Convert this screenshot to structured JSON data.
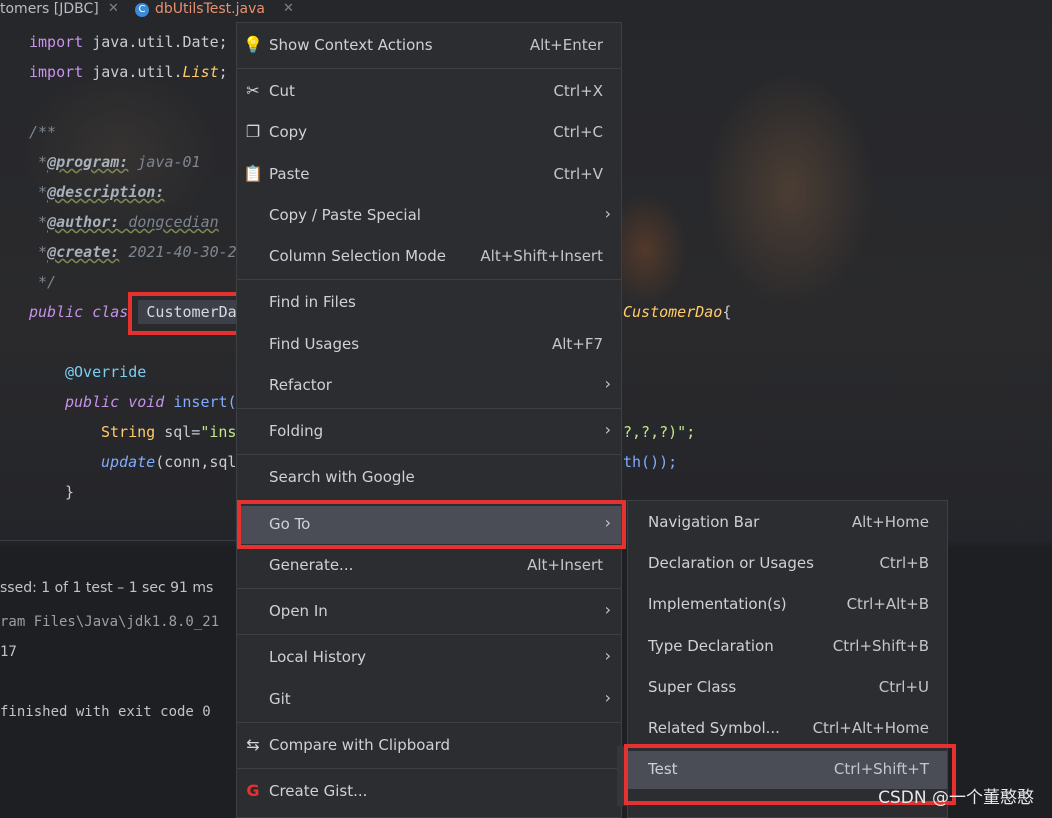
{
  "tabs": [
    {
      "label": "tomers [JDBC]",
      "close": "✕"
    },
    {
      "label": "dbUtilsTest.java",
      "close": "✕"
    }
  ],
  "code": {
    "l1_import": "import",
    "l1_rest": " java.util.Date;",
    "l2_import": "import",
    "l2_pkg": " java.util.",
    "l2_cls": "List",
    "l2_semi": ";",
    "l4": "/**",
    "l5_star": " *",
    "l5_tag": "@program:",
    "l5_val": " java-01",
    "l6_star": " *",
    "l6_tag": "@description:",
    "l7_star": " *",
    "l7_tag": "@author:",
    "l7_val": " dongcedian",
    "l8_star": " *",
    "l8_tag": "@create:",
    "l8_val": " 2021-40-30-2",
    "l9": " */",
    "l10_kw": "public",
    "l10_kw2": "clas",
    "l10_cls": "CustomerDa",
    "l10_iface": "CustomerDao",
    "l10_brace": "{",
    "l12_ann": "@Override",
    "l13_kw": "public",
    "l13_kw2": "void",
    "l13_fn": "insert(",
    "l14_type": "String",
    "l14_var": " sql=",
    "l14_str": "\"ins",
    "l14_tail": "?,?,?)\";",
    "l15_fn": "update",
    "l15_rest": "(conn,sql",
    "l15_tail": "th());",
    "l16": "}"
  },
  "run": {
    "status": "ssed: 1 of 1 test – 1 sec 91 ms",
    "path": "ram Files\\Java\\jdk1.8.0_21",
    "line2": "17",
    "exit": "finished with exit code 0"
  },
  "menu": {
    "items": [
      {
        "label": "Show Context Actions",
        "shortcut": "Alt+Enter",
        "icon": "bulb-icon"
      },
      {
        "label": "Cut",
        "shortcut": "Ctrl+X",
        "icon": "scissors-icon"
      },
      {
        "label": "Copy",
        "shortcut": "Ctrl+C",
        "icon": "copy-icon"
      },
      {
        "label": "Paste",
        "shortcut": "Ctrl+V",
        "icon": "clipboard-icon"
      },
      {
        "label": "Copy / Paste Special",
        "arrow": "›"
      },
      {
        "label": "Column Selection Mode",
        "shortcut": "Alt+Shift+Insert"
      },
      {
        "label": "Find in Files"
      },
      {
        "label": "Find Usages",
        "shortcut": "Alt+F7"
      },
      {
        "label": "Refactor",
        "arrow": "›"
      },
      {
        "label": "Folding",
        "arrow": "›"
      },
      {
        "label": "Search with Google"
      },
      {
        "label": "Go To",
        "arrow": "›"
      },
      {
        "label": "Generate...",
        "shortcut": "Alt+Insert"
      },
      {
        "label": "Open In",
        "arrow": "›"
      },
      {
        "label": "Local History",
        "arrow": "›"
      },
      {
        "label": "Git",
        "arrow": "›"
      },
      {
        "label": "Compare with Clipboard",
        "icon": "compare-icon"
      },
      {
        "label": "Create Gist...",
        "icon": "gist-icon"
      }
    ]
  },
  "submenu": {
    "items": [
      {
        "label": "Navigation Bar",
        "shortcut": "Alt+Home"
      },
      {
        "label": "Declaration or Usages",
        "shortcut": "Ctrl+B"
      },
      {
        "label": "Implementation(s)",
        "shortcut": "Ctrl+Alt+B"
      },
      {
        "label": "Type Declaration",
        "shortcut": "Ctrl+Shift+B"
      },
      {
        "label": "Super Class",
        "shortcut": "Ctrl+U"
      },
      {
        "label": "Related Symbol...",
        "shortcut": "Ctrl+Alt+Home"
      },
      {
        "label": "Test",
        "shortcut": "Ctrl+Shift+T"
      }
    ]
  },
  "watermark": "CSDN @一个董憨憨",
  "colors": {
    "accent_box": "#e5312f",
    "menu_bg": "#2b2d31",
    "active_item": "#4a4d55"
  }
}
